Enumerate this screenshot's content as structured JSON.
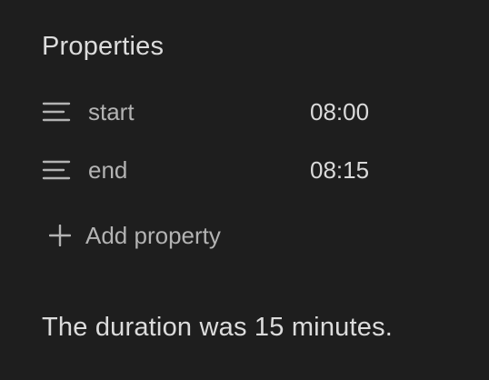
{
  "properties": {
    "heading": "Properties",
    "items": [
      {
        "icon": "text-lines-icon",
        "key": "start",
        "value": "08:00"
      },
      {
        "icon": "text-lines-icon",
        "key": "end",
        "value": "08:15"
      }
    ],
    "add_label": "Add property",
    "add_icon": "plus-icon"
  },
  "note": {
    "body": "The duration was 15 minutes."
  },
  "colors": {
    "background": "#1e1e1e",
    "text_primary": "#dcdcdc",
    "text_muted": "#b3b3b3"
  }
}
